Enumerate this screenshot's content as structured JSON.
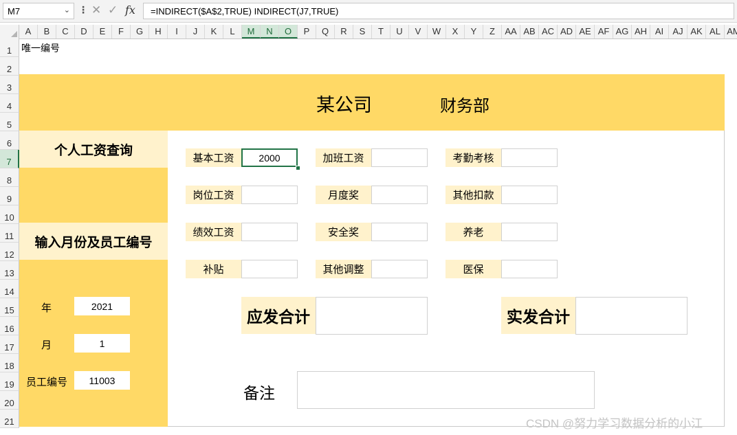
{
  "formula_bar": {
    "name_box": "M7",
    "formula": "=INDIRECT($A$2,TRUE) INDIRECT(J7,TRUE)"
  },
  "columns": [
    "A",
    "B",
    "C",
    "D",
    "E",
    "F",
    "G",
    "H",
    "I",
    "J",
    "K",
    "L",
    "M",
    "N",
    "O",
    "P",
    "Q",
    "R",
    "S",
    "T",
    "U",
    "V",
    "W",
    "X",
    "Y",
    "Z",
    "AA",
    "AB",
    "AC",
    "AD",
    "AE",
    "AF",
    "AG",
    "AH",
    "AI",
    "AJ",
    "AK",
    "AL",
    "AM"
  ],
  "selected_columns": [
    "M",
    "N",
    "O"
  ],
  "rows": [
    "1",
    "2",
    "3",
    "4",
    "5",
    "6",
    "7",
    "8",
    "9",
    "10",
    "11",
    "12",
    "13",
    "14",
    "15",
    "16",
    "17",
    "18",
    "19",
    "20",
    "21"
  ],
  "selected_row": "7",
  "sheet": {
    "a1_text": "唯一编号",
    "company": "某公司",
    "department": "财务部",
    "left_panel": {
      "query_title": "个人工资查询",
      "input_title": "输入月份及员工编号",
      "params": [
        {
          "label": "年",
          "value": "2021"
        },
        {
          "label": "月",
          "value": "1"
        },
        {
          "label": "员工编号",
          "value": "11003"
        }
      ]
    },
    "fields": [
      {
        "label": "基本工资",
        "value": "2000"
      },
      {
        "label": "加班工资",
        "value": ""
      },
      {
        "label": "考勤考核",
        "value": ""
      },
      {
        "label": "岗位工资",
        "value": ""
      },
      {
        "label": "月度奖",
        "value": ""
      },
      {
        "label": "其他扣款",
        "value": ""
      },
      {
        "label": "绩效工资",
        "value": ""
      },
      {
        "label": "安全奖",
        "value": ""
      },
      {
        "label": "养老",
        "value": ""
      },
      {
        "label": "补贴",
        "value": ""
      },
      {
        "label": "其他调整",
        "value": ""
      },
      {
        "label": "医保",
        "value": ""
      }
    ],
    "gross_total_label": "应发合计",
    "net_total_label": "实发合计",
    "note_label": "备注"
  },
  "watermark": "CSDN @努力学习数据分析的小江",
  "colors": {
    "band": "#ffd966",
    "label_fill": "#fff2cc",
    "selection": "#217346"
  }
}
